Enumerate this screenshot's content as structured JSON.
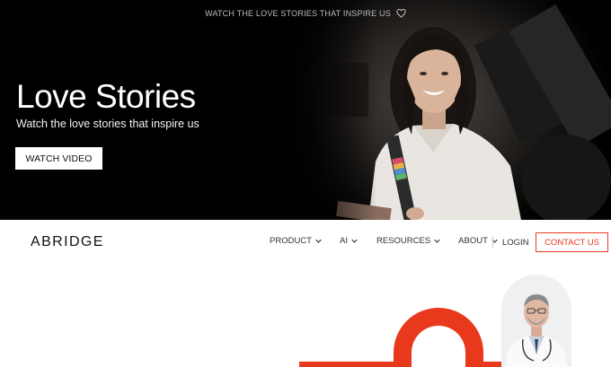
{
  "announcement": {
    "text": "WATCH THE LOVE STORIES THAT INSPIRE US",
    "icon": "heart-icon"
  },
  "hero": {
    "title": "Love Stories",
    "subtitle": "Watch the love stories that inspire us",
    "cta_label": "WATCH VIDEO"
  },
  "nav": {
    "logo": "ABRIDGE",
    "items": [
      {
        "label": "PRODUCT",
        "icon": "chevron-down-icon"
      },
      {
        "label": "AI",
        "icon": "chevron-down-icon"
      },
      {
        "label": "RESOURCES",
        "icon": "chevron-down-icon"
      },
      {
        "label": "ABOUT",
        "icon": "chevron-down-icon"
      }
    ],
    "login_label": "LOGIN",
    "contact_label": "CONTACT US"
  },
  "colors": {
    "accent": "#e8391d",
    "hero_bg": "#000000",
    "text_dark": "#111111"
  }
}
